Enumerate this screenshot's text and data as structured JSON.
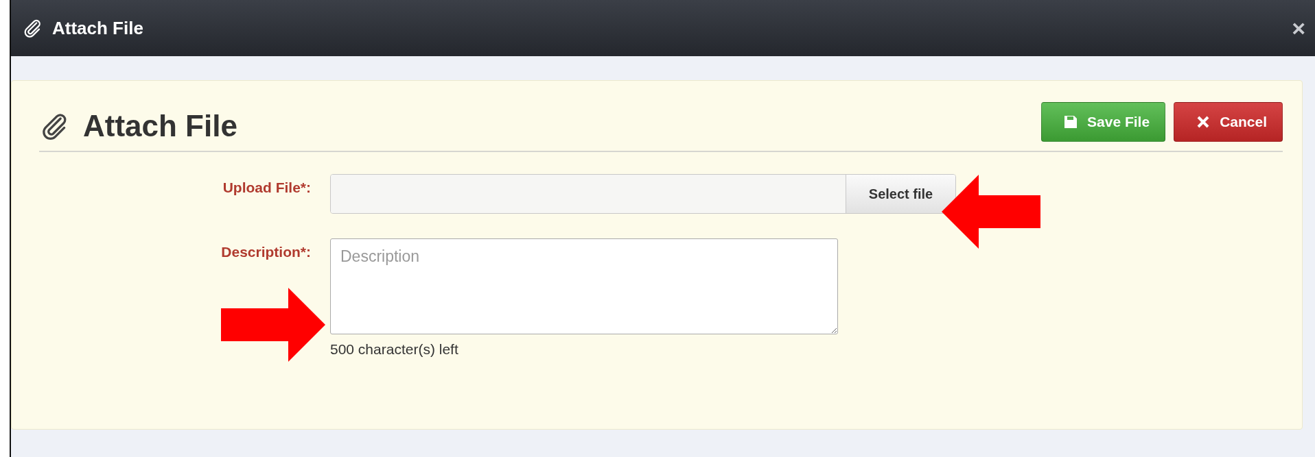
{
  "window": {
    "title": "Attach File",
    "close": "×"
  },
  "panel": {
    "heading": "Attach File",
    "buttons": [
      {
        "kind": "save",
        "label": "Save File"
      },
      {
        "kind": "cancel",
        "label": "Cancel"
      }
    ]
  },
  "form": {
    "upload": {
      "label": "Upload File*:",
      "button": "Select file"
    },
    "description": {
      "label": "Description*:",
      "placeholder": "Description",
      "counter": "500 character(s) left"
    }
  }
}
